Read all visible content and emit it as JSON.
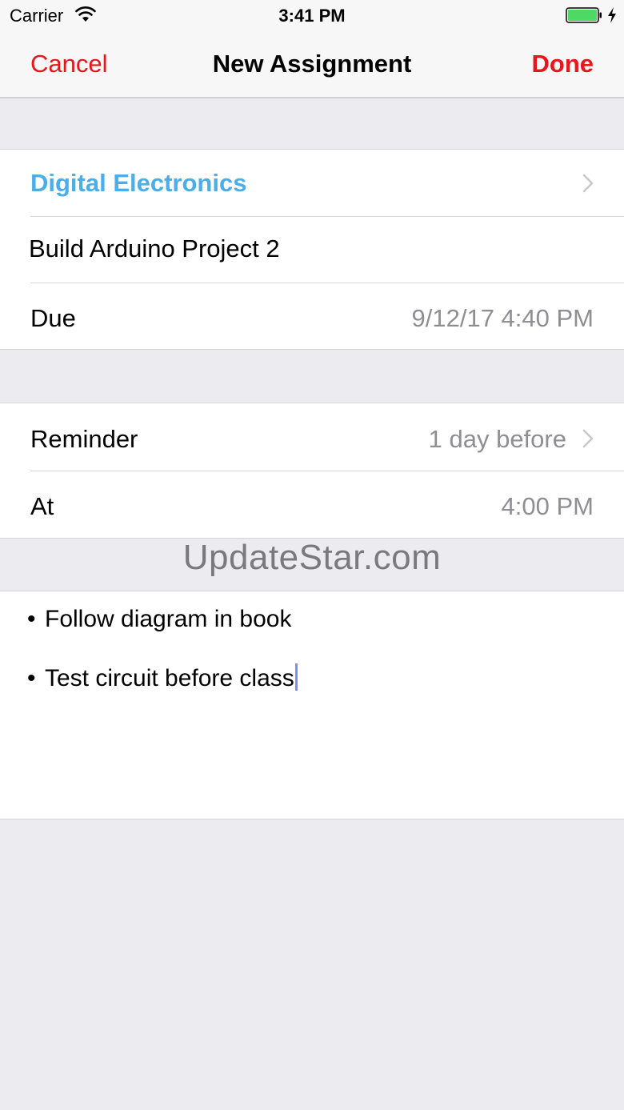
{
  "status_bar": {
    "carrier": "Carrier",
    "time": "3:41 PM",
    "battery_color": "#4cd964"
  },
  "nav": {
    "cancel_label": "Cancel",
    "title": "New Assignment",
    "done_label": "Done",
    "accent_color": "#e8151b"
  },
  "assignment": {
    "course": "Digital Electronics",
    "course_color": "#4aaee8",
    "title_value": "Build Arduino Project 2",
    "due_label": "Due",
    "due_value": "9/12/17 4:40 PM"
  },
  "reminder": {
    "label": "Reminder",
    "value": "1 day before",
    "at_label": "At",
    "at_value": "4:00 PM"
  },
  "watermark": "UpdateStar.com",
  "notes": {
    "bullet": "•",
    "lines": [
      "Follow diagram in book",
      "Test circuit before class"
    ]
  }
}
